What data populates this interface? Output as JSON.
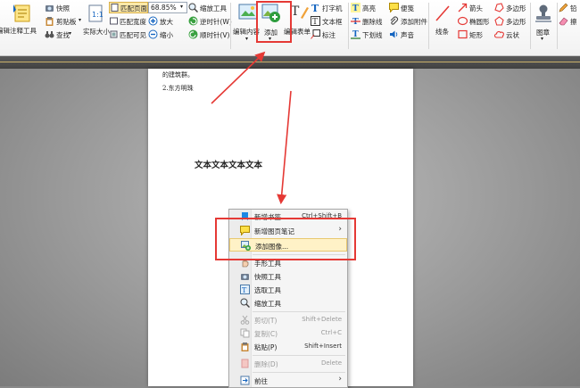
{
  "ribbon": {
    "edit_annot_tool": "编辑注释工具",
    "snapshot": "快照",
    "clipboard": "剪贴板",
    "find": "查找",
    "actual_size": "实际大小",
    "fit_page": "匹配页面",
    "fit_width": "匹配宽度",
    "fit_visible": "匹配可见",
    "zoom_value": "68.85%",
    "zoom_tool": "缩放工具",
    "zoom_in": "放大",
    "zoom_out": "缩小",
    "rotate_ccw": "逆时针(W)",
    "rotate_cw": "顺时针(V)",
    "edit_content": "编辑内容",
    "add": "添加",
    "edit_form": "编辑表单",
    "typewriter": "打字机",
    "textbox": "文本框",
    "callout": "标注",
    "highlight": "高亮",
    "strikeout": "删除线",
    "underline": "下划线",
    "note": "便笺",
    "attach_file": "添加附件",
    "sound": "声音",
    "line": "线条",
    "arrow": "箭头",
    "ellipse": "椭圆形",
    "rectangle": "矩形",
    "polygon": "多边形",
    "polyline": "多边形",
    "cloud": "云状",
    "stamp": "图章",
    "pencil": "铅",
    "eraser": "擦"
  },
  "document": {
    "line1": "的建筑群。",
    "line2": "2.东方明珠",
    "heading": "文本文本文本文本"
  },
  "context_menu": {
    "items": [
      {
        "label": "新增书签",
        "shortcut": "Ctrl+Shift+B",
        "icon": "bookmark-add-icon"
      },
      {
        "label": "新增图页笔记",
        "shortcut": "",
        "icon": "sticky-note-icon"
      },
      {
        "label": "添加图像...",
        "shortcut": "",
        "icon": "image-add-icon"
      },
      {
        "label": "手形工具",
        "shortcut": "",
        "icon": "hand-tool-icon"
      },
      {
        "label": "快照工具",
        "shortcut": "",
        "icon": "camera-icon"
      },
      {
        "label": "选取工具",
        "shortcut": "",
        "icon": "select-tool-icon"
      },
      {
        "label": "缩放工具",
        "shortcut": "",
        "icon": "zoom-tool-icon"
      },
      {
        "label": "剪切(T)",
        "shortcut": "Shift+Delete",
        "icon": "cut-icon"
      },
      {
        "label": "复制(C)",
        "shortcut": "Ctrl+C",
        "icon": "copy-icon"
      },
      {
        "label": "粘贴(P)",
        "shortcut": "Shift+Insert",
        "icon": "paste-icon"
      },
      {
        "label": "删除(D)",
        "shortcut": "Delete",
        "icon": "delete-icon"
      },
      {
        "label": "前往",
        "shortcut": "",
        "icon": "goto-icon"
      }
    ],
    "submenu_arrow": "›"
  },
  "colors": {
    "annotation_red": "#e53935",
    "highlight": "#fff2c7"
  }
}
